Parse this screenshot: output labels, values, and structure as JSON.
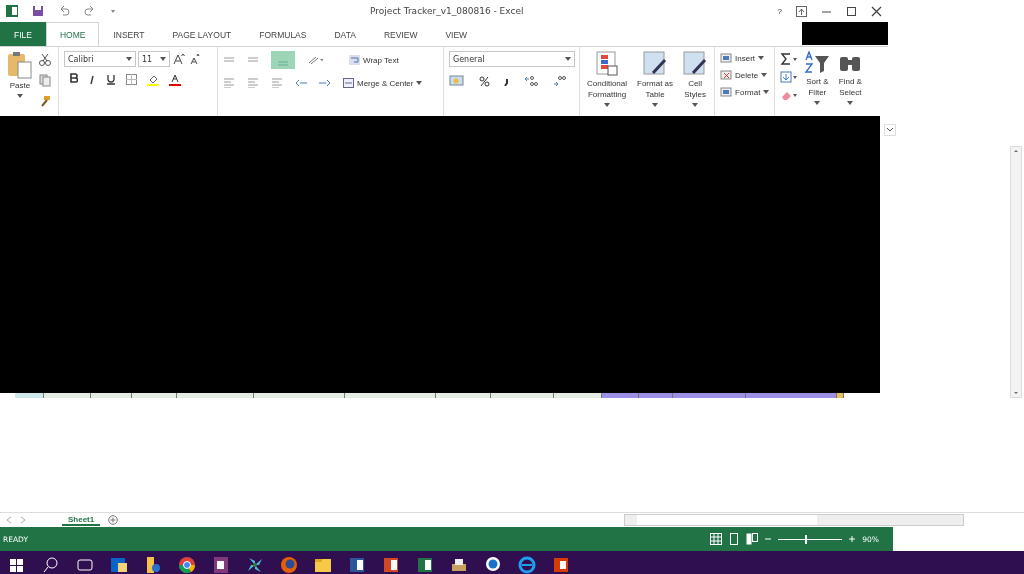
{
  "window": {
    "title": "Project Tracker_v1_080816 - Excel",
    "help": "?"
  },
  "tabs": [
    {
      "label": "FILE",
      "kind": "file",
      "selected": false
    },
    {
      "label": "HOME",
      "kind": "tab",
      "selected": true
    },
    {
      "label": "INSERT",
      "kind": "tab",
      "selected": false
    },
    {
      "label": "PAGE LAYOUT",
      "kind": "tab",
      "selected": false
    },
    {
      "label": "FORMULAS",
      "kind": "tab",
      "selected": false
    },
    {
      "label": "DATA",
      "kind": "tab",
      "selected": false
    },
    {
      "label": "REVIEW",
      "kind": "tab",
      "selected": false
    },
    {
      "label": "VIEW",
      "kind": "tab",
      "selected": false
    }
  ],
  "ribbon": {
    "paste": "Paste",
    "font_name": "Calibri",
    "font_size": "11",
    "wrap_text": "Wrap Text",
    "merge_center": "Merge & Center",
    "number_format": "General",
    "styles": [
      {
        "label": "Conditional\nFormatting"
      },
      {
        "label": "Format as\nTable"
      },
      {
        "label": "Cell\nStyles"
      }
    ],
    "cells": [
      {
        "label": "Insert"
      },
      {
        "label": "Delete"
      },
      {
        "label": "Format"
      }
    ],
    "editing": [
      {
        "label": "Sort &\nFilter"
      },
      {
        "label": "Find &\nSelect"
      }
    ]
  },
  "sheets": [
    {
      "label": "Sheet1",
      "selected": true
    }
  ],
  "status_bar": {
    "text": "READY",
    "zoom": "90%",
    "level": 0.42
  }
}
